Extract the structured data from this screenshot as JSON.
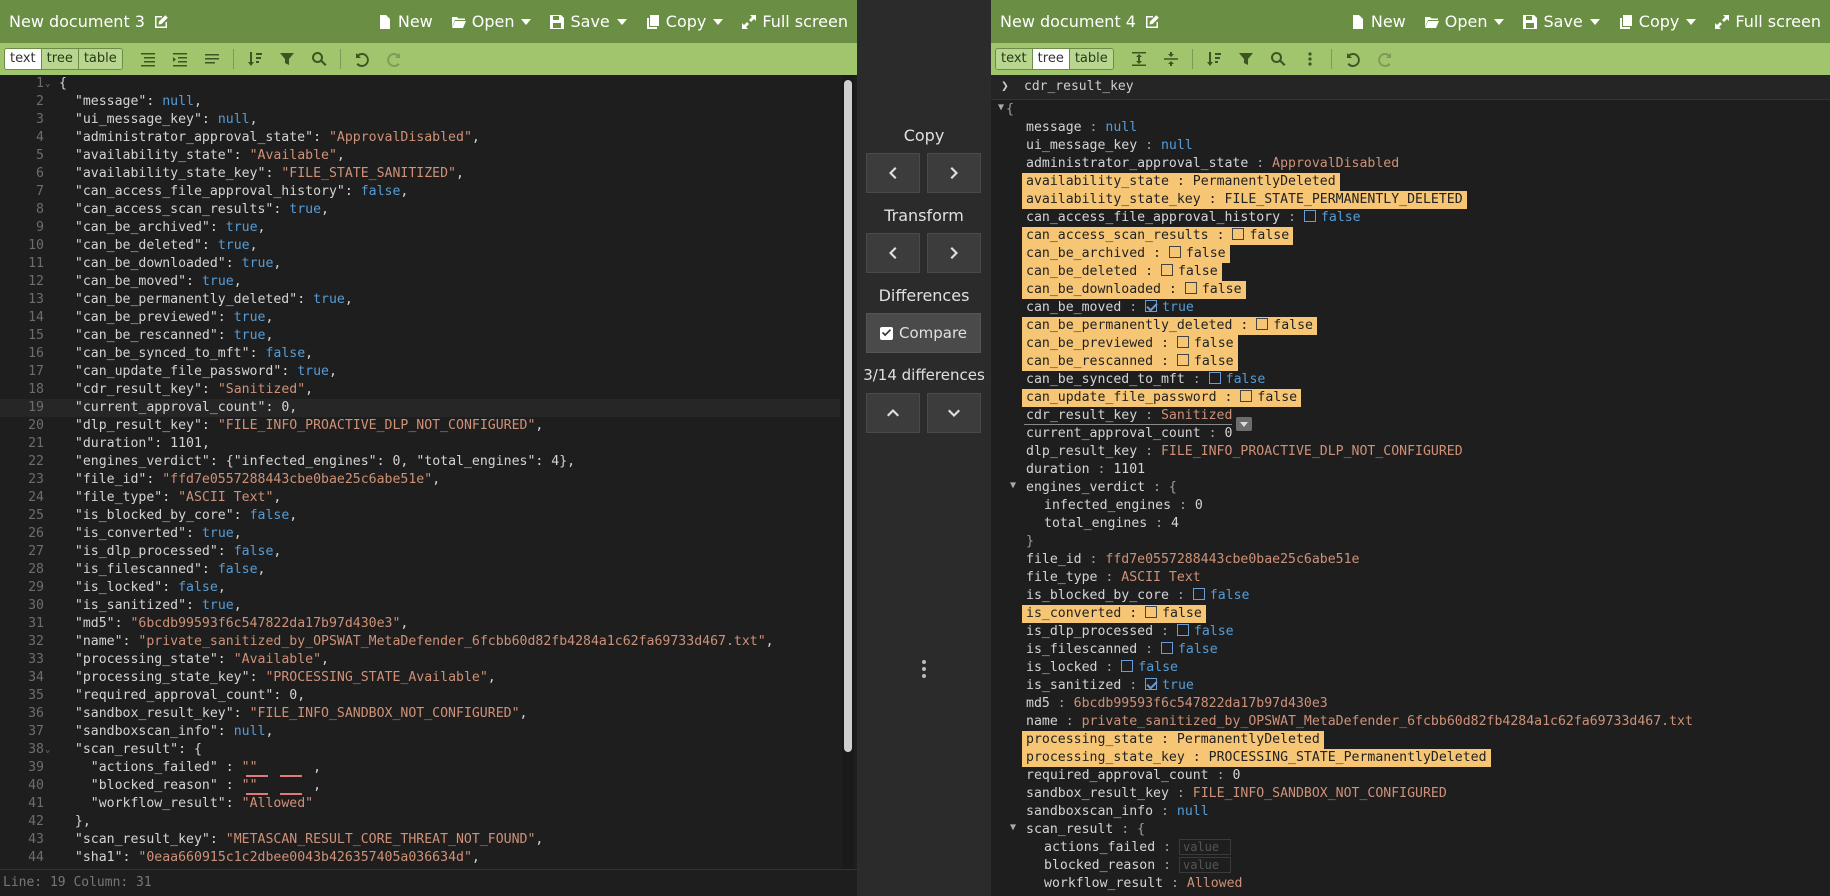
{
  "left": {
    "title": "New document 3",
    "menu": {
      "new": "New",
      "open": "Open",
      "save": "Save",
      "copy": "Copy",
      "fullscreen": "Full screen"
    },
    "modes": [
      "text",
      "tree",
      "table"
    ],
    "lines": [
      [
        [
          "k",
          "{"
        ]
      ],
      [
        [
          "k",
          "  \"message\""
        ],
        [
          "n",
          ": "
        ],
        [
          "b",
          "null"
        ],
        [
          "n",
          ","
        ]
      ],
      [
        [
          "k",
          "  \"ui_message_key\""
        ],
        [
          "n",
          ": "
        ],
        [
          "b",
          "null"
        ],
        [
          "n",
          ","
        ]
      ],
      [
        [
          "k",
          "  \"administrator_approval_state\""
        ],
        [
          "n",
          ": "
        ],
        [
          "s",
          "\"ApprovalDisabled\""
        ],
        [
          "n",
          ","
        ]
      ],
      [
        [
          "k",
          "  \"availability_state\""
        ],
        [
          "n",
          ": "
        ],
        [
          "s",
          "\"Available\""
        ],
        [
          "n",
          ","
        ]
      ],
      [
        [
          "k",
          "  \"availability_state_key\""
        ],
        [
          "n",
          ": "
        ],
        [
          "s",
          "\"FILE_STATE_SANITIZED\""
        ],
        [
          "n",
          ","
        ]
      ],
      [
        [
          "k",
          "  \"can_access_file_approval_history\""
        ],
        [
          "n",
          ": "
        ],
        [
          "b",
          "false"
        ],
        [
          "n",
          ","
        ]
      ],
      [
        [
          "k",
          "  \"can_access_scan_results\""
        ],
        [
          "n",
          ": "
        ],
        [
          "b",
          "true"
        ],
        [
          "n",
          ","
        ]
      ],
      [
        [
          "k",
          "  \"can_be_archived\""
        ],
        [
          "n",
          ": "
        ],
        [
          "b",
          "true"
        ],
        [
          "n",
          ","
        ]
      ],
      [
        [
          "k",
          "  \"can_be_deleted\""
        ],
        [
          "n",
          ": "
        ],
        [
          "b",
          "true"
        ],
        [
          "n",
          ","
        ]
      ],
      [
        [
          "k",
          "  \"can_be_downloaded\""
        ],
        [
          "n",
          ": "
        ],
        [
          "b",
          "true"
        ],
        [
          "n",
          ","
        ]
      ],
      [
        [
          "k",
          "  \"can_be_moved\""
        ],
        [
          "n",
          ": "
        ],
        [
          "b",
          "true"
        ],
        [
          "n",
          ","
        ]
      ],
      [
        [
          "k",
          "  \"can_be_permanently_deleted\""
        ],
        [
          "n",
          ": "
        ],
        [
          "b",
          "true"
        ],
        [
          "n",
          ","
        ]
      ],
      [
        [
          "k",
          "  \"can_be_previewed\""
        ],
        [
          "n",
          ": "
        ],
        [
          "b",
          "true"
        ],
        [
          "n",
          ","
        ]
      ],
      [
        [
          "k",
          "  \"can_be_rescanned\""
        ],
        [
          "n",
          ": "
        ],
        [
          "b",
          "true"
        ],
        [
          "n",
          ","
        ]
      ],
      [
        [
          "k",
          "  \"can_be_synced_to_mft\""
        ],
        [
          "n",
          ": "
        ],
        [
          "b",
          "false"
        ],
        [
          "n",
          ","
        ]
      ],
      [
        [
          "k",
          "  \"can_update_file_password\""
        ],
        [
          "n",
          ": "
        ],
        [
          "b",
          "true"
        ],
        [
          "n",
          ","
        ]
      ],
      [
        [
          "k",
          "  \"cdr_result_key\""
        ],
        [
          "n",
          ": "
        ],
        [
          "s",
          "\"Sanitized\""
        ],
        [
          "n",
          ","
        ]
      ],
      [
        [
          "k",
          "  \"current_approval_count\""
        ],
        [
          "n",
          ": "
        ],
        [
          "n",
          "0"
        ],
        [
          "n",
          ","
        ]
      ],
      [
        [
          "k",
          "  \"dlp_result_key\""
        ],
        [
          "n",
          ": "
        ],
        [
          "s",
          "\"FILE_INFO_PROACTIVE_DLP_NOT_CONFIGURED\""
        ],
        [
          "n",
          ","
        ]
      ],
      [
        [
          "k",
          "  \"duration\""
        ],
        [
          "n",
          ": "
        ],
        [
          "n",
          "1101"
        ],
        [
          "n",
          ","
        ]
      ],
      [
        [
          "k",
          "  \"engines_verdict\""
        ],
        [
          "n",
          ": {"
        ],
        [
          "k",
          "\"infected_engines\""
        ],
        [
          "n",
          ": 0, "
        ],
        [
          "k",
          "\"total_engines\""
        ],
        [
          "n",
          ": 4},"
        ]
      ],
      [
        [
          "k",
          "  \"file_id\""
        ],
        [
          "n",
          ": "
        ],
        [
          "s",
          "\"ffd7e0557288443cbe0bae25c6abe51e\""
        ],
        [
          "n",
          ","
        ]
      ],
      [
        [
          "k",
          "  \"file_type\""
        ],
        [
          "n",
          ": "
        ],
        [
          "s",
          "\"ASCII Text\""
        ],
        [
          "n",
          ","
        ]
      ],
      [
        [
          "k",
          "  \"is_blocked_by_core\""
        ],
        [
          "n",
          ": "
        ],
        [
          "b",
          "false"
        ],
        [
          "n",
          ","
        ]
      ],
      [
        [
          "k",
          "  \"is_converted\""
        ],
        [
          "n",
          ": "
        ],
        [
          "b",
          "true"
        ],
        [
          "n",
          ","
        ]
      ],
      [
        [
          "k",
          "  \"is_dlp_processed\""
        ],
        [
          "n",
          ": "
        ],
        [
          "b",
          "false"
        ],
        [
          "n",
          ","
        ]
      ],
      [
        [
          "k",
          "  \"is_filescanned\""
        ],
        [
          "n",
          ": "
        ],
        [
          "b",
          "false"
        ],
        [
          "n",
          ","
        ]
      ],
      [
        [
          "k",
          "  \"is_locked\""
        ],
        [
          "n",
          ": "
        ],
        [
          "b",
          "false"
        ],
        [
          "n",
          ","
        ]
      ],
      [
        [
          "k",
          "  \"is_sanitized\""
        ],
        [
          "n",
          ": "
        ],
        [
          "b",
          "true"
        ],
        [
          "n",
          ","
        ]
      ],
      [
        [
          "k",
          "  \"md5\""
        ],
        [
          "n",
          ": "
        ],
        [
          "s",
          "\"6bcdb99593f6c547822da17b97d430e3\""
        ],
        [
          "n",
          ","
        ]
      ],
      [
        [
          "k",
          "  \"name\""
        ],
        [
          "n",
          ": "
        ],
        [
          "s",
          "\"private_sanitized_by_OPSWAT_MetaDefender_6fcbb60d82fb4284a1c62fa69733d467.txt\""
        ],
        [
          "n",
          ","
        ]
      ],
      [
        [
          "k",
          "  \"processing_state\""
        ],
        [
          "n",
          ": "
        ],
        [
          "s",
          "\"Available\""
        ],
        [
          "n",
          ","
        ]
      ],
      [
        [
          "k",
          "  \"processing_state_key\""
        ],
        [
          "n",
          ": "
        ],
        [
          "s",
          "\"PROCESSING_STATE_Available\""
        ],
        [
          "n",
          ","
        ]
      ],
      [
        [
          "k",
          "  \"required_approval_count\""
        ],
        [
          "n",
          ": "
        ],
        [
          "n",
          "0"
        ],
        [
          "n",
          ","
        ]
      ],
      [
        [
          "k",
          "  \"sandbox_result_key\""
        ],
        [
          "n",
          ": "
        ],
        [
          "s",
          "\"FILE_INFO_SANDBOX_NOT_CONFIGURED\""
        ],
        [
          "n",
          ","
        ]
      ],
      [
        [
          "k",
          "  \"sandboxscan_info\""
        ],
        [
          "n",
          ": "
        ],
        [
          "b",
          "null"
        ],
        [
          "n",
          ","
        ]
      ],
      [
        [
          "k",
          "  \"scan_result\""
        ],
        [
          "n",
          ": {"
        ]
      ],
      [
        [
          "k",
          "    \"actions_failed\""
        ],
        [
          "n",
          " : "
        ],
        [
          "s",
          "\"\""
        ],
        [
          "n",
          "       ,"
        ]
      ],
      [
        [
          "k",
          "    \"blocked_reason\""
        ],
        [
          "n",
          " : "
        ],
        [
          "s",
          "\"\""
        ],
        [
          "n",
          "       ,"
        ]
      ],
      [
        [
          "k",
          "    \"workflow_result\""
        ],
        [
          "n",
          ": "
        ],
        [
          "s",
          "\"Allowed\""
        ]
      ],
      [
        [
          "n",
          "  },"
        ]
      ],
      [
        [
          "k",
          "  \"scan_result_key\""
        ],
        [
          "n",
          ": "
        ],
        [
          "s",
          "\"METASCAN_RESULT_CORE_THREAT_NOT_FOUND\""
        ],
        [
          "n",
          ","
        ]
      ],
      [
        [
          "k",
          "  \"sha1\""
        ],
        [
          "n",
          ": "
        ],
        [
          "s",
          "\"0eaa660915c1c2dbee0043b426357405a036634d\""
        ],
        [
          "n",
          ","
        ]
      ]
    ],
    "status": "Line: 19  Column: 31"
  },
  "middle": {
    "copy_label": "Copy",
    "transform_label": "Transform",
    "differences_label": "Differences",
    "compare_label": "Compare",
    "diff_count": "3/14 differences"
  },
  "right": {
    "title": "New document 4",
    "menu": {
      "new": "New",
      "open": "Open",
      "save": "Save",
      "copy": "Copy",
      "fullscreen": "Full screen"
    },
    "modes": [
      "text",
      "tree",
      "table"
    ],
    "breadcrumb": "cdr_result_key",
    "rows": [
      {
        "indent": 0,
        "type": "open",
        "key": "",
        "val": "{"
      },
      {
        "indent": 1,
        "key": "message",
        "val": "null",
        "vt": "b"
      },
      {
        "indent": 1,
        "key": "ui_message_key",
        "val": "null",
        "vt": "b"
      },
      {
        "indent": 1,
        "key": "administrator_approval_state",
        "val": "ApprovalDisabled",
        "vt": "s"
      },
      {
        "indent": 1,
        "key": "availability_state",
        "val": "PermanentlyDeleted",
        "vt": "s",
        "diff": true
      },
      {
        "indent": 1,
        "key": "availability_state_key",
        "val": "FILE_STATE_PERMANENTLY_DELETED",
        "vt": "s",
        "diff": true
      },
      {
        "indent": 1,
        "key": "can_access_file_approval_history",
        "val": "false",
        "vt": "bool",
        "checked": false
      },
      {
        "indent": 1,
        "key": "can_access_scan_results",
        "val": "false",
        "vt": "bool",
        "checked": false,
        "diff": true
      },
      {
        "indent": 1,
        "key": "can_be_archived",
        "val": "false",
        "vt": "bool",
        "checked": false,
        "diff": true
      },
      {
        "indent": 1,
        "key": "can_be_deleted",
        "val": "false",
        "vt": "bool",
        "checked": false,
        "diff": true
      },
      {
        "indent": 1,
        "key": "can_be_downloaded",
        "val": "false",
        "vt": "bool",
        "checked": false,
        "diff": true
      },
      {
        "indent": 1,
        "key": "can_be_moved",
        "val": "true",
        "vt": "bool",
        "checked": true
      },
      {
        "indent": 1,
        "key": "can_be_permanently_deleted",
        "val": "false",
        "vt": "bool",
        "checked": false,
        "diff": true
      },
      {
        "indent": 1,
        "key": "can_be_previewed",
        "val": "false",
        "vt": "bool",
        "checked": false,
        "diff": true
      },
      {
        "indent": 1,
        "key": "can_be_rescanned",
        "val": "false",
        "vt": "bool",
        "checked": false,
        "diff": true
      },
      {
        "indent": 1,
        "key": "can_be_synced_to_mft",
        "val": "false",
        "vt": "bool",
        "checked": false
      },
      {
        "indent": 1,
        "key": "can_update_file_password",
        "val": "false",
        "vt": "bool",
        "checked": false,
        "diff": true
      },
      {
        "indent": 1,
        "key": "cdr_result_key",
        "val": "Sanitized",
        "vt": "s",
        "selected": true
      },
      {
        "indent": 1,
        "key": "current_approval_count",
        "val": "0",
        "vt": "n"
      },
      {
        "indent": 1,
        "key": "dlp_result_key",
        "val": "FILE_INFO_PROACTIVE_DLP_NOT_CONFIGURED",
        "vt": "s"
      },
      {
        "indent": 1,
        "key": "duration",
        "val": "1101",
        "vt": "n"
      },
      {
        "indent": 1,
        "type": "objopen",
        "key": "engines_verdict",
        "val": "{"
      },
      {
        "indent": 2,
        "key": "infected_engines",
        "val": "0",
        "vt": "n"
      },
      {
        "indent": 2,
        "key": "total_engines",
        "val": "4",
        "vt": "n"
      },
      {
        "indent": 1,
        "type": "close",
        "key": "",
        "val": "}"
      },
      {
        "indent": 1,
        "key": "file_id",
        "val": "ffd7e0557288443cbe0bae25c6abe51e",
        "vt": "s"
      },
      {
        "indent": 1,
        "key": "file_type",
        "val": "ASCII Text",
        "vt": "s"
      },
      {
        "indent": 1,
        "key": "is_blocked_by_core",
        "val": "false",
        "vt": "bool",
        "checked": false
      },
      {
        "indent": 1,
        "key": "is_converted",
        "val": "false",
        "vt": "bool",
        "checked": false,
        "diff": true
      },
      {
        "indent": 1,
        "key": "is_dlp_processed",
        "val": "false",
        "vt": "bool",
        "checked": false
      },
      {
        "indent": 1,
        "key": "is_filescanned",
        "val": "false",
        "vt": "bool",
        "checked": false
      },
      {
        "indent": 1,
        "key": "is_locked",
        "val": "false",
        "vt": "bool",
        "checked": false
      },
      {
        "indent": 1,
        "key": "is_sanitized",
        "val": "true",
        "vt": "bool",
        "checked": true
      },
      {
        "indent": 1,
        "key": "md5",
        "val": "6bcdb99593f6c547822da17b97d430e3",
        "vt": "s"
      },
      {
        "indent": 1,
        "key": "name",
        "val": "private_sanitized_by_OPSWAT_MetaDefender_6fcbb60d82fb4284a1c62fa69733d467.txt",
        "vt": "s"
      },
      {
        "indent": 1,
        "key": "processing_state",
        "val": "PermanentlyDeleted",
        "vt": "s",
        "diff": true
      },
      {
        "indent": 1,
        "key": "processing_state_key",
        "val": "PROCESSING_STATE_PermanentlyDeleted",
        "vt": "s",
        "diff": true
      },
      {
        "indent": 1,
        "key": "required_approval_count",
        "val": "0",
        "vt": "n"
      },
      {
        "indent": 1,
        "key": "sandbox_result_key",
        "val": "FILE_INFO_SANDBOX_NOT_CONFIGURED",
        "vt": "s"
      },
      {
        "indent": 1,
        "key": "sandboxscan_info",
        "val": "null",
        "vt": "b"
      },
      {
        "indent": 1,
        "type": "objopen",
        "key": "scan_result",
        "val": "{"
      },
      {
        "indent": 2,
        "key": "actions_failed",
        "val": "value",
        "vt": "ph"
      },
      {
        "indent": 2,
        "key": "blocked_reason",
        "val": "value",
        "vt": "ph"
      },
      {
        "indent": 2,
        "key": "workflow_result",
        "val": "Allowed",
        "vt": "s"
      }
    ]
  },
  "colors": {
    "menubar": "#6a8f44",
    "toolbar": "#a0c56c",
    "diff_highlight": "#f6c675"
  }
}
